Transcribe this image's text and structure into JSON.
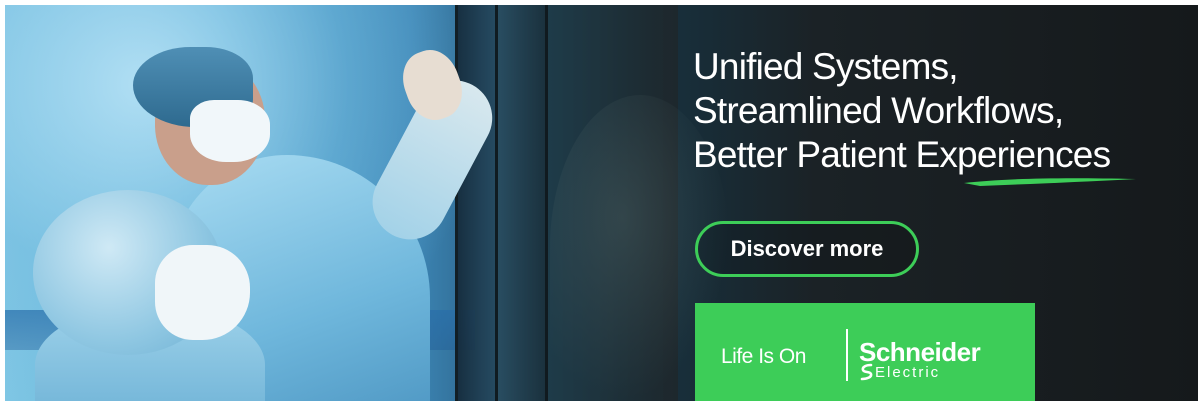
{
  "ad": {
    "headline_lines": [
      "Unified Systems,",
      "Streamlined Workflows,",
      "Better Patient Experiences"
    ],
    "cta_label": "Discover more",
    "tagline": "Life Is On",
    "brand_name": "Schneider",
    "brand_sub": "Electric"
  },
  "colors": {
    "brand_green": "#3dcd58",
    "text": "#ffffff"
  }
}
